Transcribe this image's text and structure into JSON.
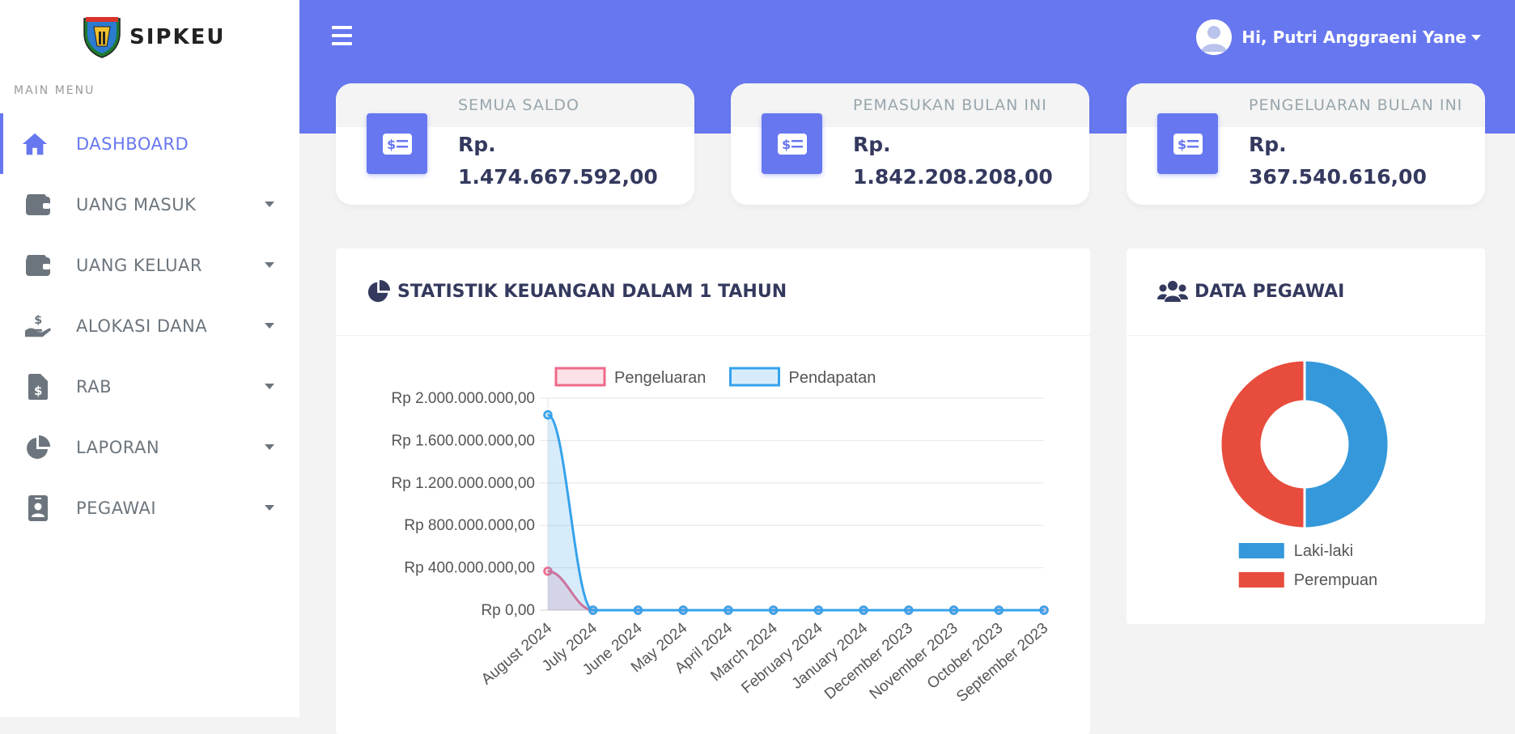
{
  "brand": {
    "name": "SIPKEU",
    "logo_icon": "regional-crest-logo"
  },
  "sidebar": {
    "heading": "MAIN MENU",
    "items": [
      {
        "label": "DASHBOARD",
        "icon": "home-icon",
        "active": true
      },
      {
        "label": "UANG MASUK",
        "icon": "wallet-icon",
        "dropdown": true
      },
      {
        "label": "UANG KELUAR",
        "icon": "wallet-icon",
        "dropdown": true
      },
      {
        "label": "ALOKASI DANA",
        "icon": "hand-holding-usd-icon",
        "dropdown": true
      },
      {
        "label": "RAB",
        "icon": "file-invoice-dollar-icon",
        "dropdown": true
      },
      {
        "label": "LAPORAN",
        "icon": "chart-pie-icon",
        "dropdown": true
      },
      {
        "label": "PEGAWAI",
        "icon": "id-badge-icon",
        "dropdown": true
      }
    ]
  },
  "topbar": {
    "user_greeting": "Hi, Putri Anggraeni Yane",
    "accent": "#6777ef"
  },
  "cards": [
    {
      "title": "SEMUA SALDO",
      "value": "Rp. 1.474.667.592,00",
      "icon": "money-bill-icon"
    },
    {
      "title": "PEMASUKAN BULAN INI",
      "value": "Rp. 1.842.208.208,00",
      "icon": "money-bill-icon"
    },
    {
      "title": "PENGELUARAN BULAN INI",
      "value": "Rp. 367.540.616,00",
      "icon": "money-bill-icon"
    }
  ],
  "stats_panel": {
    "title": "STATISTIK KEUANGAN DALAM 1 TAHUN",
    "icon": "chart-pie-icon"
  },
  "employee_panel": {
    "title": "DATA PEGAWAI",
    "icon": "users-icon"
  },
  "chart_data": [
    {
      "type": "line",
      "categories": [
        "August 2024",
        "July 2024",
        "June 2024",
        "May 2024",
        "April 2024",
        "March 2024",
        "February 2024",
        "January 2024",
        "December 2023",
        "November 2023",
        "October 2023",
        "September 2023"
      ],
      "series": [
        {
          "name": "Pengeluaran",
          "color": "#ef6a8a",
          "values": [
            367540616,
            0,
            0,
            0,
            0,
            0,
            0,
            0,
            0,
            0,
            0,
            0
          ]
        },
        {
          "name": "Pendapatan",
          "color": "#36a2eb",
          "values": [
            1842208208,
            0,
            0,
            0,
            0,
            0,
            0,
            0,
            0,
            0,
            0,
            0
          ]
        }
      ],
      "yticks": [
        "Rp 0,00",
        "Rp 400.000.000,00",
        "Rp 800.000.000,00",
        "Rp 1.200.000.000,00",
        "Rp 1.600.000.000,00",
        "Rp 2.000.000.000,00"
      ],
      "ylim": [
        0,
        2000000000
      ],
      "legend": "top",
      "grid": true
    },
    {
      "type": "pie",
      "labels": [
        "Laki-laki",
        "Perempuan"
      ],
      "values": [
        50,
        50
      ],
      "colors": [
        "#3498db",
        "#e74c3c"
      ],
      "legend": "bottom"
    }
  ]
}
